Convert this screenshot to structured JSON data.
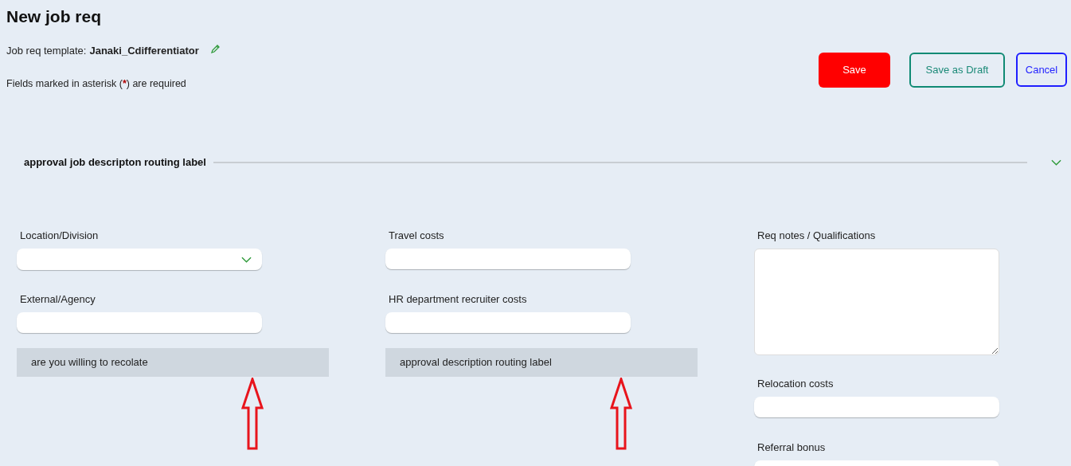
{
  "title": "New job req",
  "template": {
    "label": "Job req template:",
    "value": "Janaki_Cdifferentiator"
  },
  "required_note": {
    "before": "Fields marked in asterisk (",
    "mark": "*",
    "after": ") are required"
  },
  "buttons": [
    {
      "kind": "primary",
      "label": "Save"
    },
    {
      "kind": "outline-teal",
      "label": "Save as Draft"
    },
    {
      "kind": "outline-blue",
      "label": "Cancel"
    }
  ],
  "section": {
    "title": "approval job descripton routing label",
    "expanded": true
  },
  "columns": [
    [
      {
        "kind": "select",
        "label": "Location/Division"
      },
      {
        "kind": "input",
        "label": "External/Agency"
      },
      {
        "kind": "bar",
        "label": "are you willing to recolate",
        "annotated": true
      }
    ],
    [
      {
        "kind": "input",
        "label": "Travel costs"
      },
      {
        "kind": "input",
        "label": "HR department recruiter costs"
      },
      {
        "kind": "bar",
        "label": "approval description routing label",
        "annotated": true
      }
    ],
    [
      {
        "kind": "textarea",
        "label": "Req notes / Qualifications"
      },
      {
        "kind": "input",
        "label": "Relocation costs"
      },
      {
        "kind": "input",
        "label": "Referral bonus"
      }
    ]
  ]
}
